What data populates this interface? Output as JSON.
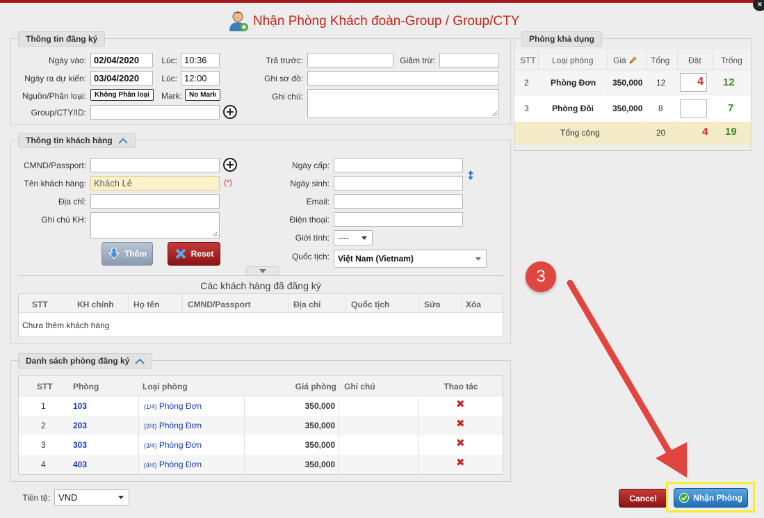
{
  "dialog": {
    "title": "Nhận Phòng Khách đoàn-Group / Group/CTY",
    "close_glyph": "×"
  },
  "registration": {
    "legend": "Thông tin đăng ký",
    "checkin_label": "Ngày vào:",
    "checkin_date": "02/04/2020",
    "time_label_in": "Lúc:",
    "checkin_time": "10:36",
    "checkout_label": "Ngày ra dự kiến:",
    "checkout_date": "03/04/2020",
    "time_label_out": "Lúc:",
    "checkout_time": "12:00",
    "source_label": "Nguồn/Phân loại:",
    "source_value": "Không Phân loại",
    "mark_label": "Mark:",
    "mark_value": "No Mark",
    "group_label": "Group/CTY/ID:",
    "prepaid_label": "Trả trước:",
    "discount_label": "Giảm trừ:",
    "map_note_label": "Ghi sơ đồ:",
    "note_label": "Ghi chú:"
  },
  "customer": {
    "legend": "Thông tin khách hàng",
    "id_label": "CMND/Passport:",
    "name_label": "Tên khách hàng:",
    "name_value": "Khách Lẻ",
    "required_mark": "(*)",
    "address_label": "Địa chỉ:",
    "note_label": "Ghi chú KH:",
    "issue_date_label": "Ngày cấp:",
    "birth_label": "Ngày sinh:",
    "email_label": "Email:",
    "phone_label": "Điện thoại:",
    "gender_label": "Giới tính:",
    "gender_value": "----",
    "nationality_label": "Quốc tịch:",
    "nationality_value": "Việt Nam (Vietnam)",
    "add_label": "Thêm",
    "reset_label": "Reset"
  },
  "registered_guests": {
    "title": "Các khách hàng đã đăng ký",
    "columns": [
      "STT",
      "KH chính",
      "Họ tên",
      "CMND/Passport",
      "Địa chỉ",
      "Quốc tịch",
      "Sửa",
      "Xóa"
    ],
    "empty_text": "Chưa thêm khách hàng"
  },
  "room_list": {
    "legend": "Danh sách phòng đăng ký",
    "columns": [
      "STT",
      "Phòng",
      "Loại phòng",
      "Giá phòng",
      "Ghi chú",
      "Thao tác"
    ],
    "rows": [
      {
        "stt": "1",
        "room": "103",
        "seq": "(1/4)",
        "type": "Phòng Đơn",
        "price": "350,000"
      },
      {
        "stt": "2",
        "room": "203",
        "seq": "(2/4)",
        "type": "Phòng Đơn",
        "price": "350,000"
      },
      {
        "stt": "3",
        "room": "303",
        "seq": "(3/4)",
        "type": "Phòng Đơn",
        "price": "350,000"
      },
      {
        "stt": "4",
        "room": "403",
        "seq": "(4/4)",
        "type": "Phòng Đơn",
        "price": "350,000"
      }
    ],
    "delete_glyph": "✖"
  },
  "available_rooms": {
    "legend": "Phòng khả dụng",
    "columns": [
      "STT",
      "Loại phòng",
      "Giá",
      "Tổng",
      "Đặt",
      "Trống"
    ],
    "rows": [
      {
        "stt": "2",
        "type": "Phòng Đơn",
        "price": "350,000",
        "total": "12",
        "booked": "4",
        "free": "12"
      },
      {
        "stt": "3",
        "type": "Phòng Đôi",
        "price": "350,000",
        "total": "8",
        "booked": "",
        "free": "7"
      }
    ],
    "summary": {
      "label": "Tổng cộng",
      "total": "20",
      "booked": "4",
      "free": "19"
    }
  },
  "footer": {
    "currency_label": "Tiền tệ:",
    "currency_value": "VND",
    "cancel_label": "Cancel",
    "checkin_label": "Nhận Phòng"
  },
  "annotation": {
    "step": "3"
  },
  "colors": {
    "title": "#c0271d",
    "accent_red": "#e02020",
    "accent_green": "#3a8a2e",
    "link_blue": "#1a3bb5",
    "highlight_yellow": "#f5ee2a"
  }
}
